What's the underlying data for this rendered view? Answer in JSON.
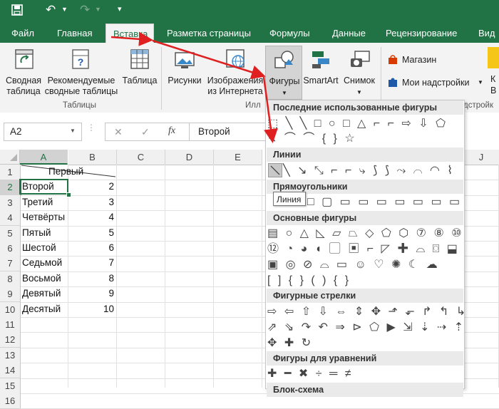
{
  "app": {
    "accent": "#217346",
    "tabs": [
      "Файл",
      "Главная",
      "Вставка",
      "Разметка страницы",
      "Формулы",
      "Данные",
      "Рецензирование",
      "Вид"
    ],
    "active_tab": "Вставка"
  },
  "ribbon": {
    "pivot_table": "Сводная\nтаблица",
    "recommended_pivot": "Рекомендуемые\nсводные таблицы",
    "table": "Таблица",
    "tables_group": "Таблицы",
    "pictures": "Рисунки",
    "online_pictures": "Изображения\nиз Интернета",
    "shapes": "Фигуры",
    "smartart": "SmartArt",
    "screenshot": "Снимок",
    "illustrations_group": "Илл",
    "store": "Магазин",
    "my_addins": "Мои надстройки",
    "addins_group": "дстройк",
    "right_cut_1": "К",
    "right_cut_2": "В"
  },
  "formula_bar": {
    "name_box": "A2",
    "cancel": "✕",
    "enter": "✓",
    "fx": "fx",
    "value": "Второй"
  },
  "grid": {
    "columns": [
      "A",
      "B",
      "C",
      "D",
      "E",
      "J"
    ],
    "rows": [
      "1",
      "2",
      "3",
      "4",
      "5",
      "6",
      "7",
      "8",
      "9",
      "10",
      "11",
      "12",
      "13",
      "14",
      "15",
      "16"
    ],
    "header_cell": "Первый",
    "names": [
      "Второй",
      "Третий",
      "Четвёрты",
      "Пятый",
      "Шестой",
      "Седьмой",
      "Восьмой",
      "Девятый",
      "Десятый"
    ],
    "numbers": [
      "2",
      "3",
      "4",
      "5",
      "6",
      "7",
      "8",
      "9",
      "10"
    ]
  },
  "shapes_menu": {
    "sections": [
      "Последние использованные фигуры",
      "Линии",
      "Прямоугольники",
      "Основные фигуры",
      "Фигурные стрелки",
      "Фигуры для уравнений",
      "Блок-схема"
    ],
    "tooltip": "Линия",
    "recent_row1": "⬚ ╲ ╲ □ ○ □ △ ⌐ ⌐ ⇨ ⇩ ⬠",
    "recent_row2": "↖ ⌒ ⌒ { } ☆",
    "lines_row": "╲ ↘ ⤡ ⌐ ⌐ ⤷ ⟆ ⟆ ⤳ ⌒ ◠ ⌇",
    "rect_row": "□ ▢ ▭ ▭ ▭ ▭ ▭ ▭ ▭",
    "basic_row1": "▤ ○ △ ◺ ▱ ⏢ ◇ ⬠ ⬡ ⑦ ⑧ ⑩",
    "basic_row2": "⑫ ◔ ◕ ◖ ▢ ▣ ⌐ ◸ ✚ ⌓ ⌼ ⬓",
    "basic_row3": "▣ ◎ ⊘ ⌓ ▭ ☺ ♡ ✺ ☾ ☁",
    "basic_row4": "[ ] { } ( ) { }",
    "arrows_row1": "⇨ ⇦ ⇧ ⇩ ⇔ ⇕ ✥ ⬏ ⬐ ↱ ↰ ↳",
    "arrows_row2": "⇗ ⇘ ↷ ↶ ⇒ ⊳ ⬠ ▶ ⇲ ⇣ ⇢ ⇡",
    "arrows_row3": "✥ ✚ ↻",
    "eq_row": "✚ ━ ✖ ÷ ═ ≠"
  }
}
